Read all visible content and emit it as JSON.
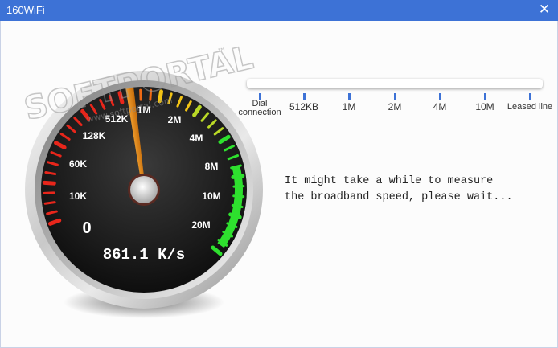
{
  "window": {
    "title": "160WiFi",
    "close_glyph": "✕"
  },
  "gauge": {
    "labels": [
      "0",
      "10K",
      "60K",
      "128K",
      "512K",
      "1M",
      "2M",
      "4M",
      "8M",
      "10M",
      "20M"
    ],
    "readout": "861.1 K/s",
    "needle_value_label": "1M"
  },
  "speed_scale": {
    "labels": [
      {
        "text": "Dial\nconnection"
      },
      {
        "text": "512KB"
      },
      {
        "text": "1M"
      },
      {
        "text": "2M"
      },
      {
        "text": "4M"
      },
      {
        "text": "10M"
      },
      {
        "text": "Leased line"
      }
    ]
  },
  "status": {
    "message": "It might take a while to measure\nthe broadband speed, please wait..."
  },
  "watermark": {
    "brand": "SOFTPORTAL",
    "url": "www.softportal.com",
    "mark": "™"
  },
  "colors": {
    "titlebar": "#3d72d6",
    "accent_green": "#2ee02e",
    "accent_red": "#e8261b",
    "accent_yellow": "#f2c315"
  }
}
